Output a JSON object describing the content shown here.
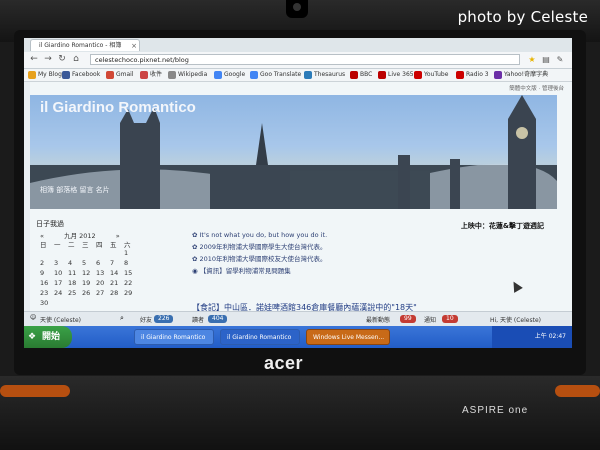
{
  "watermark": "photo by Celeste",
  "device": {
    "brand": "acer",
    "model": "ASPIRE one"
  },
  "browser": {
    "tab_title": "il Giardino Romantico - 相簿",
    "url": "celestechoco.pixnet.net/blog",
    "bookmarks": [
      {
        "label": "My Blog",
        "color": "#e7a11d"
      },
      {
        "label": "Facebook",
        "color": "#3b5998"
      },
      {
        "label": "Gmail",
        "color": "#d14836"
      },
      {
        "label": "收件",
        "color": "#c44"
      },
      {
        "label": "Wikipedia",
        "color": "#888"
      },
      {
        "label": "Google",
        "color": "#4285f4"
      },
      {
        "label": "Goo Translate",
        "color": "#4285f4"
      },
      {
        "label": "Thesaurus",
        "color": "#2b7bb9"
      },
      {
        "label": "BBC",
        "color": "#b00"
      },
      {
        "label": "Live 365",
        "color": "#b00"
      },
      {
        "label": "YouTube",
        "color": "#c00"
      },
      {
        "label": "Radio 3",
        "color": "#c00"
      },
      {
        "label": "Yahoo!奇摩字典",
        "color": "#6b2ea6"
      }
    ]
  },
  "page": {
    "lang_links": "簡體中文版 · 管理後台",
    "banner_title": "il Giardino Romantico",
    "banner_links": "相簿 部落格 留言 名片",
    "sidebar_title": "日子我過",
    "calendar": {
      "month": "九月 2012",
      "prev": "«",
      "next": "»",
      "weekdays": [
        "日",
        "一",
        "二",
        "三",
        "四",
        "五",
        "六"
      ],
      "weeks": [
        [
          "",
          "",
          "",
          "",
          "",
          "",
          "1"
        ],
        [
          "2",
          "3",
          "4",
          "5",
          "6",
          "7",
          "8"
        ],
        [
          "9",
          "10",
          "11",
          "12",
          "13",
          "14",
          "15"
        ],
        [
          "16",
          "17",
          "18",
          "19",
          "20",
          "21",
          "22"
        ],
        [
          "23",
          "24",
          "25",
          "26",
          "27",
          "28",
          "29"
        ],
        [
          "30",
          "",
          "",
          "",
          "",
          "",
          ""
        ]
      ]
    },
    "now_playing": "上映中：花蓮&擊丁遊週記",
    "posts": [
      "It's not what you do, but how you do it.",
      "2009年利物浦大學國際學生大使台灣代表。",
      "2010年利物浦大學國際校友大使台灣代表。",
      "【資訊】留學利物浦常見問題集"
    ],
    "headline": "【食記】中山區．諾娃啤酒館346倉庫餐廳內蘊漢說中的\"18天\""
  },
  "status_bar": {
    "user": "天使 (Celeste)",
    "friends_label": "好友",
    "friends_count": "226",
    "readers_label": "讀者",
    "readers_count": "404",
    "recent_label": "最新動態",
    "recent_count": "99",
    "notice_label": "通知",
    "notice_count": "10",
    "user2": "Hi, 天使 (Celeste)"
  },
  "taskbar": {
    "start": "開始",
    "tasks": [
      "il Giardino Romantico",
      "il Giardino Romantico",
      "Windows Live Messen..."
    ],
    "time": "上午 02:47"
  }
}
